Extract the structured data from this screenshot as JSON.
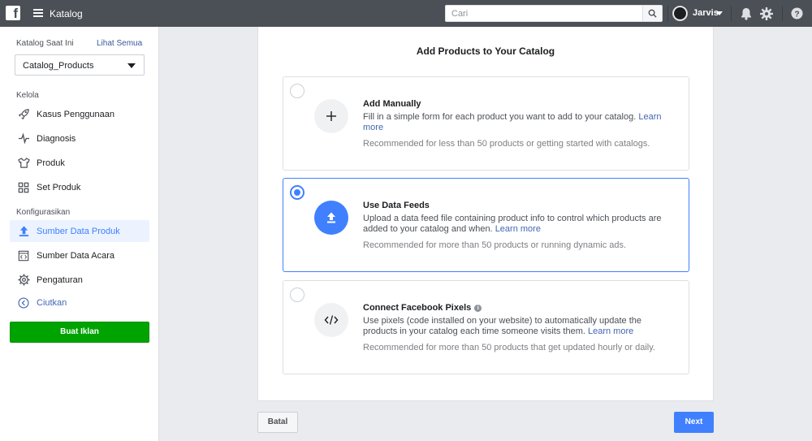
{
  "topbar": {
    "logo": "f",
    "app_title": "Katalog",
    "search_placeholder": "Cari",
    "user_name": "Jarvis"
  },
  "sidebar": {
    "current_label": "Katalog Saat Ini",
    "see_all": "Lihat Semua",
    "catalog_selected": "Catalog_Products",
    "section_manage": "Kelola",
    "manage_items": [
      {
        "label": "Kasus Penggunaan",
        "icon": "rocket-icon"
      },
      {
        "label": "Diagnosis",
        "icon": "pulse-icon"
      },
      {
        "label": "Produk",
        "icon": "shirt-icon"
      },
      {
        "label": "Set Produk",
        "icon": "grid-icon"
      }
    ],
    "section_config": "Konfigurasikan",
    "config_items": [
      {
        "label": "Sumber Data Produk",
        "icon": "upload-icon",
        "active": true
      },
      {
        "label": "Sumber Data Acara",
        "icon": "code-window-icon"
      },
      {
        "label": "Pengaturan",
        "icon": "gear-icon"
      }
    ],
    "collapse_label": "Ciutkan",
    "cta_label": "Buat Iklan"
  },
  "main": {
    "title": "Add Products to Your Catalog",
    "options": [
      {
        "title": "Add Manually",
        "desc": "Fill in a simple form for each product you want to add to your catalog.",
        "link": "Learn more",
        "recommendation": "Recommended for less than 50 products or getting started with catalogs.",
        "icon": "plus-icon",
        "selected": false
      },
      {
        "title": "Use Data Feeds",
        "desc": "Upload a data feed file containing product info to control which products are added to your catalog and when.",
        "link": "Learn more",
        "recommendation": "Recommended for more than 50 products or running dynamic ads.",
        "icon": "upload-icon",
        "selected": true
      },
      {
        "title": "Connect Facebook Pixels",
        "desc": "Use pixels (code installed on your website) to automatically update the products in your catalog each time someone visits them.",
        "link": "Learn more",
        "recommendation": "Recommended for more than 50 products that get updated hourly or daily.",
        "icon": "code-icon",
        "selected": false,
        "info_icon": "i"
      }
    ]
  },
  "footer": {
    "cancel_label": "Batal",
    "next_label": "Next"
  },
  "colors": {
    "topbar": "#4b4f56",
    "accent": "#4080ff",
    "cta": "#00a400",
    "link": "#4267b2"
  }
}
